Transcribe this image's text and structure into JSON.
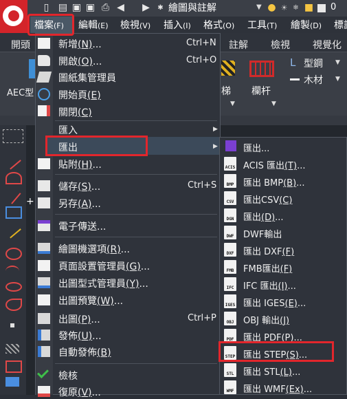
{
  "quick_access": {
    "workspace": "繪圖與註解",
    "count": "0"
  },
  "menubar": {
    "items": [
      {
        "label": "檔案",
        "key": "(F)"
      },
      {
        "label": "編輯",
        "key": "(E)"
      },
      {
        "label": "檢視",
        "key": "(V)"
      },
      {
        "label": "插入",
        "key": "(I)"
      },
      {
        "label": "格式",
        "key": "(O)"
      },
      {
        "label": "工具",
        "key": "(T)"
      },
      {
        "label": "繪製",
        "key": "(D)"
      },
      {
        "label": "標註",
        "key": ""
      }
    ]
  },
  "ribbon": {
    "tabs": [
      "開頭",
      "註解",
      "檢視",
      "視覺化"
    ],
    "aec_label": "AEC型",
    "stair_label": "梯",
    "railing_label": "欄杆",
    "steel_label": "型鋼",
    "wood_label": "木材"
  },
  "file_menu": {
    "items": [
      {
        "label": "新增",
        "key": "(N)",
        "suffix": "...",
        "shortcut": "Ctrl+N"
      },
      {
        "label": "開啟",
        "key": "(O)",
        "suffix": "...",
        "shortcut": "Ctrl+O"
      },
      {
        "label": "圖紙集管理員",
        "key": "",
        "suffix": "",
        "shortcut": ""
      },
      {
        "label": "開始頁",
        "key": "(E)",
        "suffix": "",
        "shortcut": ""
      },
      {
        "label": "關閉",
        "key": "(C)",
        "suffix": "",
        "shortcut": ""
      },
      {
        "label": "匯入",
        "key": "",
        "suffix": "",
        "shortcut": ""
      },
      {
        "label": "匯出",
        "key": "",
        "suffix": "",
        "shortcut": ""
      },
      {
        "label": "貼附",
        "key": "(H)",
        "suffix": "...",
        "shortcut": ""
      },
      {
        "label": "儲存",
        "key": "(S)",
        "suffix": "...",
        "shortcut": "Ctrl+S"
      },
      {
        "label": "另存",
        "key": "(A)",
        "suffix": "...",
        "shortcut": ""
      },
      {
        "label": "電子傳送",
        "key": "",
        "suffix": "...",
        "shortcut": ""
      },
      {
        "label": "繪圖機選項",
        "key": "(R)",
        "suffix": "...",
        "shortcut": ""
      },
      {
        "label": "頁面設置管理員",
        "key": "(G)",
        "suffix": "...",
        "shortcut": ""
      },
      {
        "label": "出圖型式管理員",
        "key": "(Y)",
        "suffix": "...",
        "shortcut": ""
      },
      {
        "label": "出圖預覽",
        "key": "(W)",
        "suffix": "...",
        "shortcut": ""
      },
      {
        "label": "出圖",
        "key": "(P)",
        "suffix": "...",
        "shortcut": "Ctrl+P"
      },
      {
        "label": "發佈",
        "key": "(U)",
        "suffix": "...",
        "shortcut": ""
      },
      {
        "label": "自動發佈",
        "key": "(B)",
        "suffix": "",
        "shortcut": ""
      },
      {
        "label": "檢核",
        "key": "",
        "suffix": "",
        "shortcut": ""
      },
      {
        "label": "復原",
        "key": "(V)",
        "suffix": "...",
        "shortcut": ""
      }
    ]
  },
  "export_submenu": {
    "items": [
      {
        "label": "匯出",
        "key": "",
        "suffix": "...",
        "icon": ""
      },
      {
        "label": "ACIS 匯出",
        "key": "(T)",
        "suffix": "...",
        "icon": "ACIS"
      },
      {
        "label": "匯出 BMP",
        "key": "(B)",
        "suffix": "...",
        "icon": "BMP"
      },
      {
        "label": "匯出CSV",
        "key": "(C)",
        "suffix": "",
        "icon": "CSV"
      },
      {
        "label": "匯出",
        "key": "(D)",
        "suffix": "...",
        "icon": "DGN"
      },
      {
        "label": "DWF輸出",
        "key": "",
        "suffix": "",
        "icon": "DWF"
      },
      {
        "label": "匯出 DXF",
        "key": "(F)",
        "suffix": "",
        "icon": "DXF"
      },
      {
        "label": "FMB匯出",
        "key": "(F)",
        "suffix": "",
        "icon": "FMB"
      },
      {
        "label": "IFC 匯出",
        "key": "(I)",
        "suffix": "...",
        "icon": "IFC"
      },
      {
        "label": "匯出 IGES",
        "key": "(E)",
        "suffix": "...",
        "icon": "IGES"
      },
      {
        "label": "OBJ 輸出",
        "key": "(J)",
        "suffix": "",
        "icon": "OBJ"
      },
      {
        "label": "匯出 PDF",
        "key": "(P)",
        "suffix": "...",
        "icon": "PDF"
      },
      {
        "label": "匯出 STEP",
        "key": "(S)",
        "suffix": "...",
        "icon": "STEP"
      },
      {
        "label": "匯出 STL",
        "key": "(L)",
        "suffix": "...",
        "icon": "STL"
      },
      {
        "label": "匯出 WMF",
        "key": "(Ex)",
        "suffix": "...",
        "icon": "WMF"
      }
    ]
  },
  "colors": {
    "highlight_box": "#e2262c",
    "logo": "#d3242a",
    "menu_bg": "#2f333b"
  }
}
